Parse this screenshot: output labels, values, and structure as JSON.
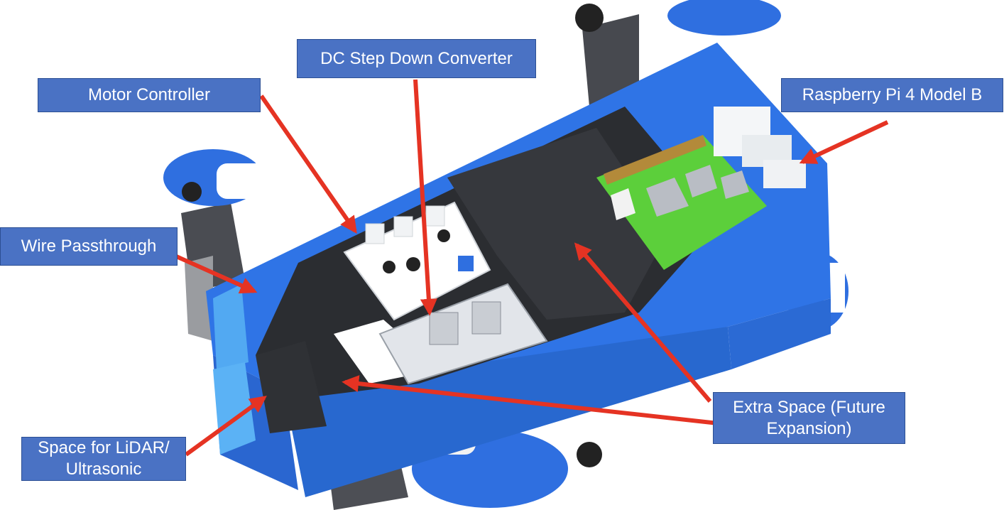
{
  "labels": {
    "dc_converter": "DC Step Down Converter",
    "motor_controller": "Motor Controller",
    "raspberry_pi": "Raspberry Pi 4 Model B",
    "wire_passthrough": "Wire Passthrough",
    "extra_space": "Extra Space (Future\nExpansion)",
    "lidar_space": "Space for LiDAR/\nUltrasonic"
  },
  "colors": {
    "callout_fill": "#4a72c4",
    "callout_text": "#ffffff",
    "arrow": "#e53323",
    "chassis_blue": "#2f74e6",
    "base_plate": "#2b2d31",
    "pi_board": "#5ccf3b",
    "servo_body": "#47494f"
  }
}
